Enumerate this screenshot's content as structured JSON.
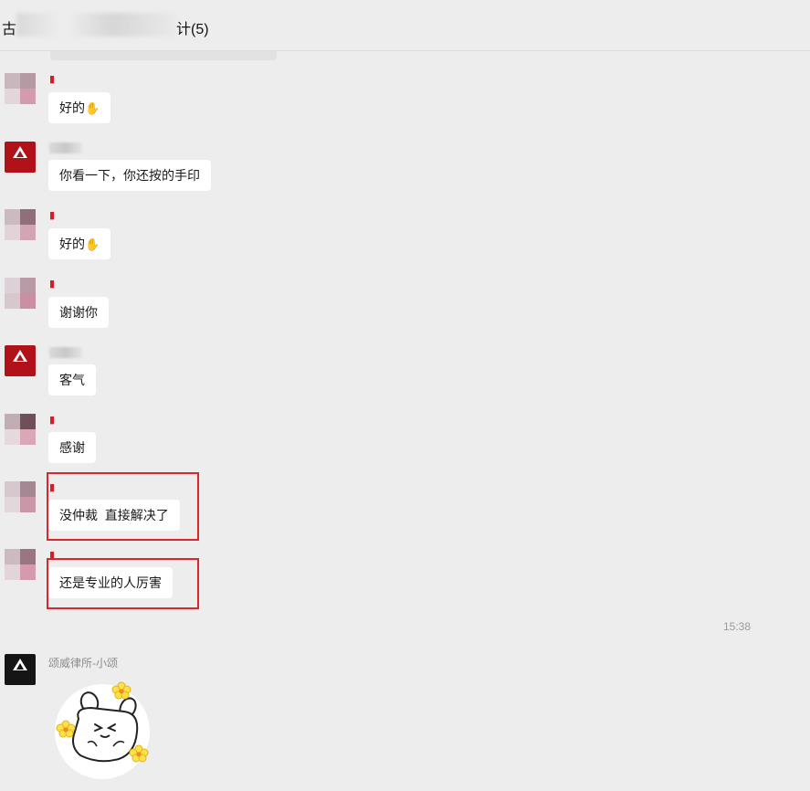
{
  "header": {
    "title_start": "古",
    "title_end": "计(5)"
  },
  "messages": [
    {
      "sender_type": "client",
      "text": "好的",
      "emoji": "ok-hand"
    },
    {
      "sender_type": "firm",
      "text": "你看一下，你还按的手印"
    },
    {
      "sender_type": "client",
      "text": "好的",
      "emoji": "ok-hand"
    },
    {
      "sender_type": "client",
      "text": "谢谢你"
    },
    {
      "sender_type": "firm",
      "text": "客气"
    },
    {
      "sender_type": "client",
      "text": "感谢"
    },
    {
      "sender_type": "client",
      "text": "没仲裁  直接解决了",
      "highlighted": true
    },
    {
      "sender_type": "client",
      "text": "还是专业的人厉害",
      "highlighted": true
    }
  ],
  "timestamp": "15:38",
  "last_message": {
    "sender_name": "颂威律所-小颂",
    "content_type": "sticker",
    "sticker": "bunny-with-flowers"
  },
  "colors": {
    "background": "#ededed",
    "bubble": "#ffffff",
    "highlight_border": "#d9272e",
    "firm_avatar": "#b1121a"
  }
}
